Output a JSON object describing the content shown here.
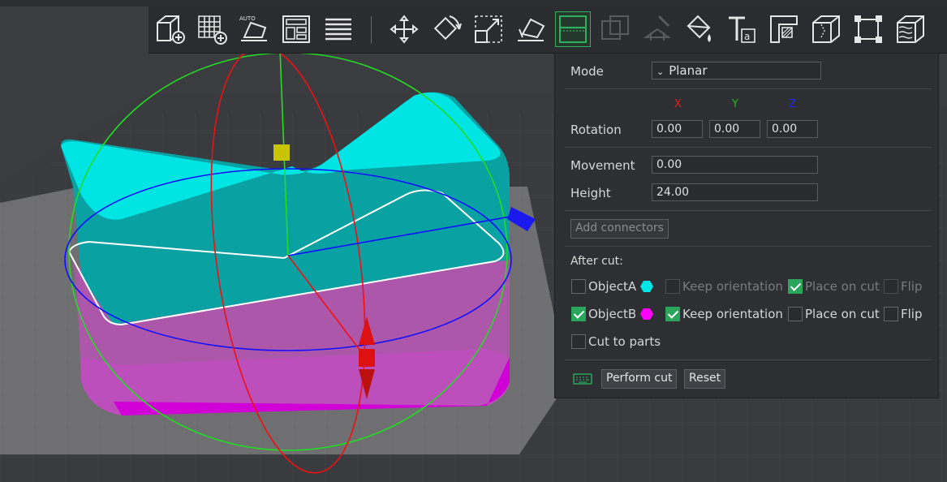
{
  "toolbar": {
    "tools": [
      {
        "icon": "add-cube-icon"
      },
      {
        "icon": "add-grid-icon"
      },
      {
        "icon": "auto-orient-icon",
        "label": "AUTO"
      },
      {
        "icon": "arrange-icon"
      },
      {
        "icon": "layers-list-icon"
      },
      {
        "icon": "move-icon"
      },
      {
        "icon": "rotate-icon"
      },
      {
        "icon": "scale-icon"
      },
      {
        "icon": "lay-on-face-icon"
      },
      {
        "icon": "cut-icon",
        "active": true
      },
      {
        "icon": "mesh-boolean-icon",
        "disabled": true
      },
      {
        "icon": "support-paint-icon",
        "disabled": true
      },
      {
        "icon": "color-paint-icon"
      },
      {
        "icon": "text-icon"
      },
      {
        "icon": "measure-icon"
      },
      {
        "icon": "seam-paint-icon"
      },
      {
        "icon": "assembly-icon"
      },
      {
        "icon": "fuzzy-skin-icon"
      }
    ]
  },
  "panel": {
    "mode_label": "Mode",
    "mode_value": "Planar",
    "axis_x": "X",
    "axis_y": "Y",
    "axis_z": "Z",
    "rotation_label": "Rotation",
    "rotation_x": "0.00",
    "rotation_y": "0.00",
    "rotation_z": "0.00",
    "movement_label": "Movement",
    "movement_value": "0.00",
    "height_label": "Height",
    "height_value": "24.00",
    "add_connectors": "Add connectors",
    "after_cut_label": "After cut:",
    "object_a": "ObjectA",
    "object_b": "ObjectB",
    "keep_orientation": "Keep orientation",
    "place_on_cut": "Place on cut",
    "flip": "Flip",
    "cut_to_parts": "Cut to parts",
    "perform_cut": "Perform cut",
    "reset": "Reset"
  },
  "colors": {
    "object_a": "#00e6e6",
    "object_b": "#ff00ff",
    "accent": "#2aa55b"
  },
  "checks": {
    "object_a": false,
    "a_keep_orientation": false,
    "a_place_on_cut": true,
    "a_flip": false,
    "object_b": true,
    "b_keep_orientation": true,
    "b_place_on_cut": false,
    "b_flip": false,
    "cut_to_parts": false
  }
}
